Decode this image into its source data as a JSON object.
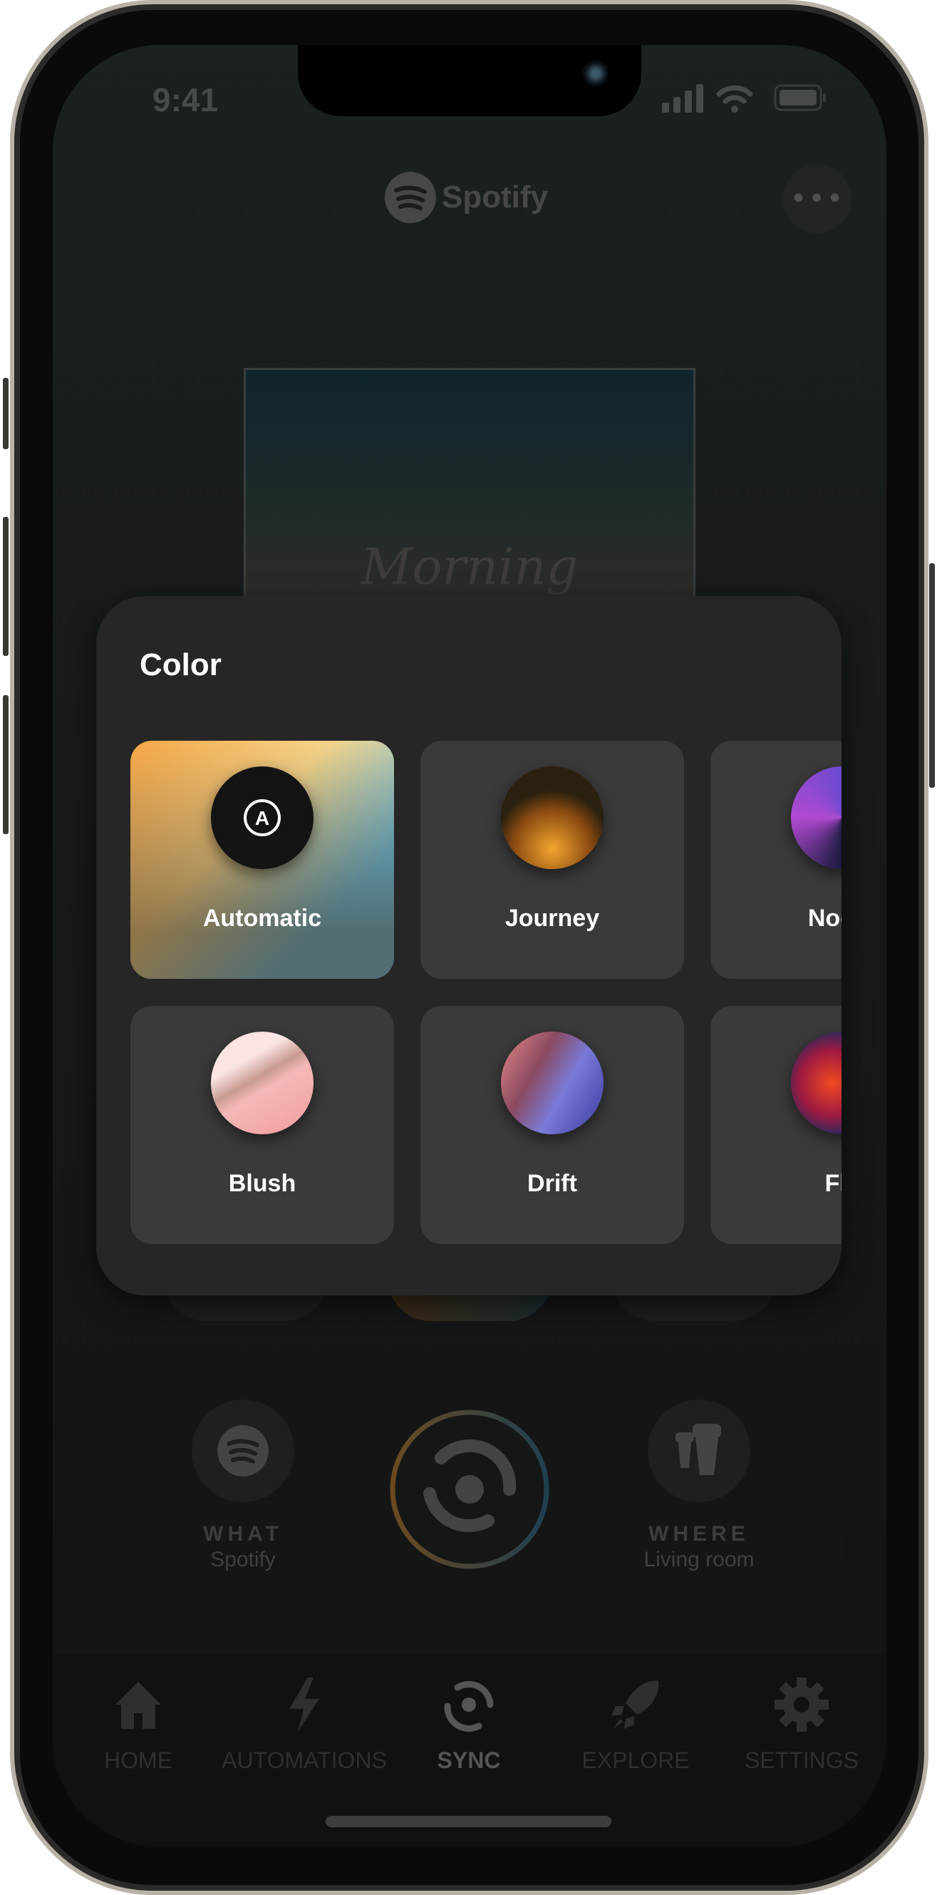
{
  "status_bar": {
    "time": "9:41"
  },
  "header": {
    "brand": "Spotify",
    "more_icon": "ellipsis-icon"
  },
  "album": {
    "title": "Morning"
  },
  "color_panel": {
    "title": "Color",
    "options": [
      {
        "label": "Automatic",
        "selected": true,
        "icon": "letter-a-icon"
      },
      {
        "label": "Journey"
      },
      {
        "label": "Noctu"
      },
      {
        "label": "Blush"
      },
      {
        "label": "Drift"
      },
      {
        "label": "Fla"
      }
    ]
  },
  "controls": {
    "what": {
      "title": "WHAT",
      "value": "Spotify"
    },
    "where": {
      "title": "WHERE",
      "value": "Living room"
    }
  },
  "tabs": [
    {
      "label": "HOME",
      "icon": "home-icon"
    },
    {
      "label": "AUTOMATIONS",
      "icon": "lightning-icon"
    },
    {
      "label": "SYNC",
      "icon": "sync-icon",
      "active": true
    },
    {
      "label": "EXPLORE",
      "icon": "rocket-icon"
    },
    {
      "label": "SETTINGS",
      "icon": "gear-icon"
    }
  ],
  "colors": {
    "accent_warm": "#f5a94a",
    "accent_cool": "#5bc0e8",
    "panel": "#262626",
    "tile": "#3a3a3a"
  }
}
